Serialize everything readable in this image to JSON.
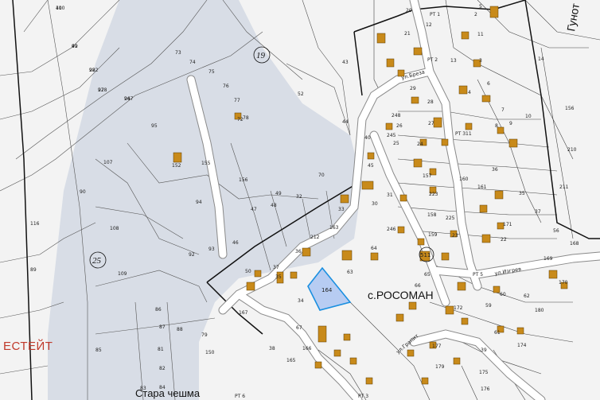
{
  "map": {
    "village_label": "с.РОСОМАН",
    "estate_label": "ЕСТЕЙТ",
    "fountain_label": "Стара чешма",
    "corner_label": "Гунот",
    "highlight_parcel": "164",
    "section_labels": [
      "19",
      "25",
      "511"
    ],
    "street_labels": [
      "ул.Изгрев",
      "ул.Гранит",
      "ул.Бреза"
    ],
    "point_labels": [
      "PT 1",
      "PT 2",
      "PT 3",
      "PT 5",
      "PT 6",
      "PT 311"
    ],
    "parcel_labels": [
      "100",
      "99",
      "98",
      "97",
      "96",
      "95",
      "94",
      "93",
      "92",
      "90",
      "89",
      "116",
      "107",
      "108",
      "109",
      "86",
      "87",
      "88",
      "81",
      "82",
      "83",
      "84",
      "85",
      "72",
      "73",
      "74",
      "75",
      "76",
      "77",
      "78",
      "79",
      "150",
      "152",
      "155",
      "156",
      "48",
      "47",
      "49",
      "46",
      "50",
      "37",
      "35",
      "36",
      "34",
      "38",
      "165",
      "166",
      "167",
      "212",
      "163",
      "33",
      "32",
      "70",
      "52",
      "43",
      "44",
      "45",
      "30",
      "31",
      "245",
      "246",
      "248",
      "29",
      "28",
      "27",
      "26",
      "25",
      "24",
      "157",
      "158",
      "159",
      "160",
      "161",
      "223",
      "225",
      "23",
      "22",
      "21",
      "20",
      "2",
      "3",
      "4",
      "5",
      "6",
      "7",
      "8",
      "9",
      "10",
      "11",
      "12",
      "13",
      "14",
      "156",
      "210",
      "211",
      "56",
      "37",
      "36",
      "35",
      "171",
      "168",
      "169",
      "170",
      "172",
      "174",
      "175",
      "176",
      "177",
      "179",
      "180",
      "59",
      "60",
      "61",
      "62",
      "63",
      "64",
      "65",
      "66",
      "67",
      "39",
      "40",
      "41",
      "42",
      "222",
      "228",
      "247"
    ],
    "colors": {
      "background": "#f3f3f3",
      "shaded_area": "#d8dde6",
      "road": "#ffffff",
      "building": "#c88a1a",
      "highlight": "#b7ccf2",
      "highlight_border": "#1a8fe0",
      "estate_text": "#c0392b"
    }
  }
}
